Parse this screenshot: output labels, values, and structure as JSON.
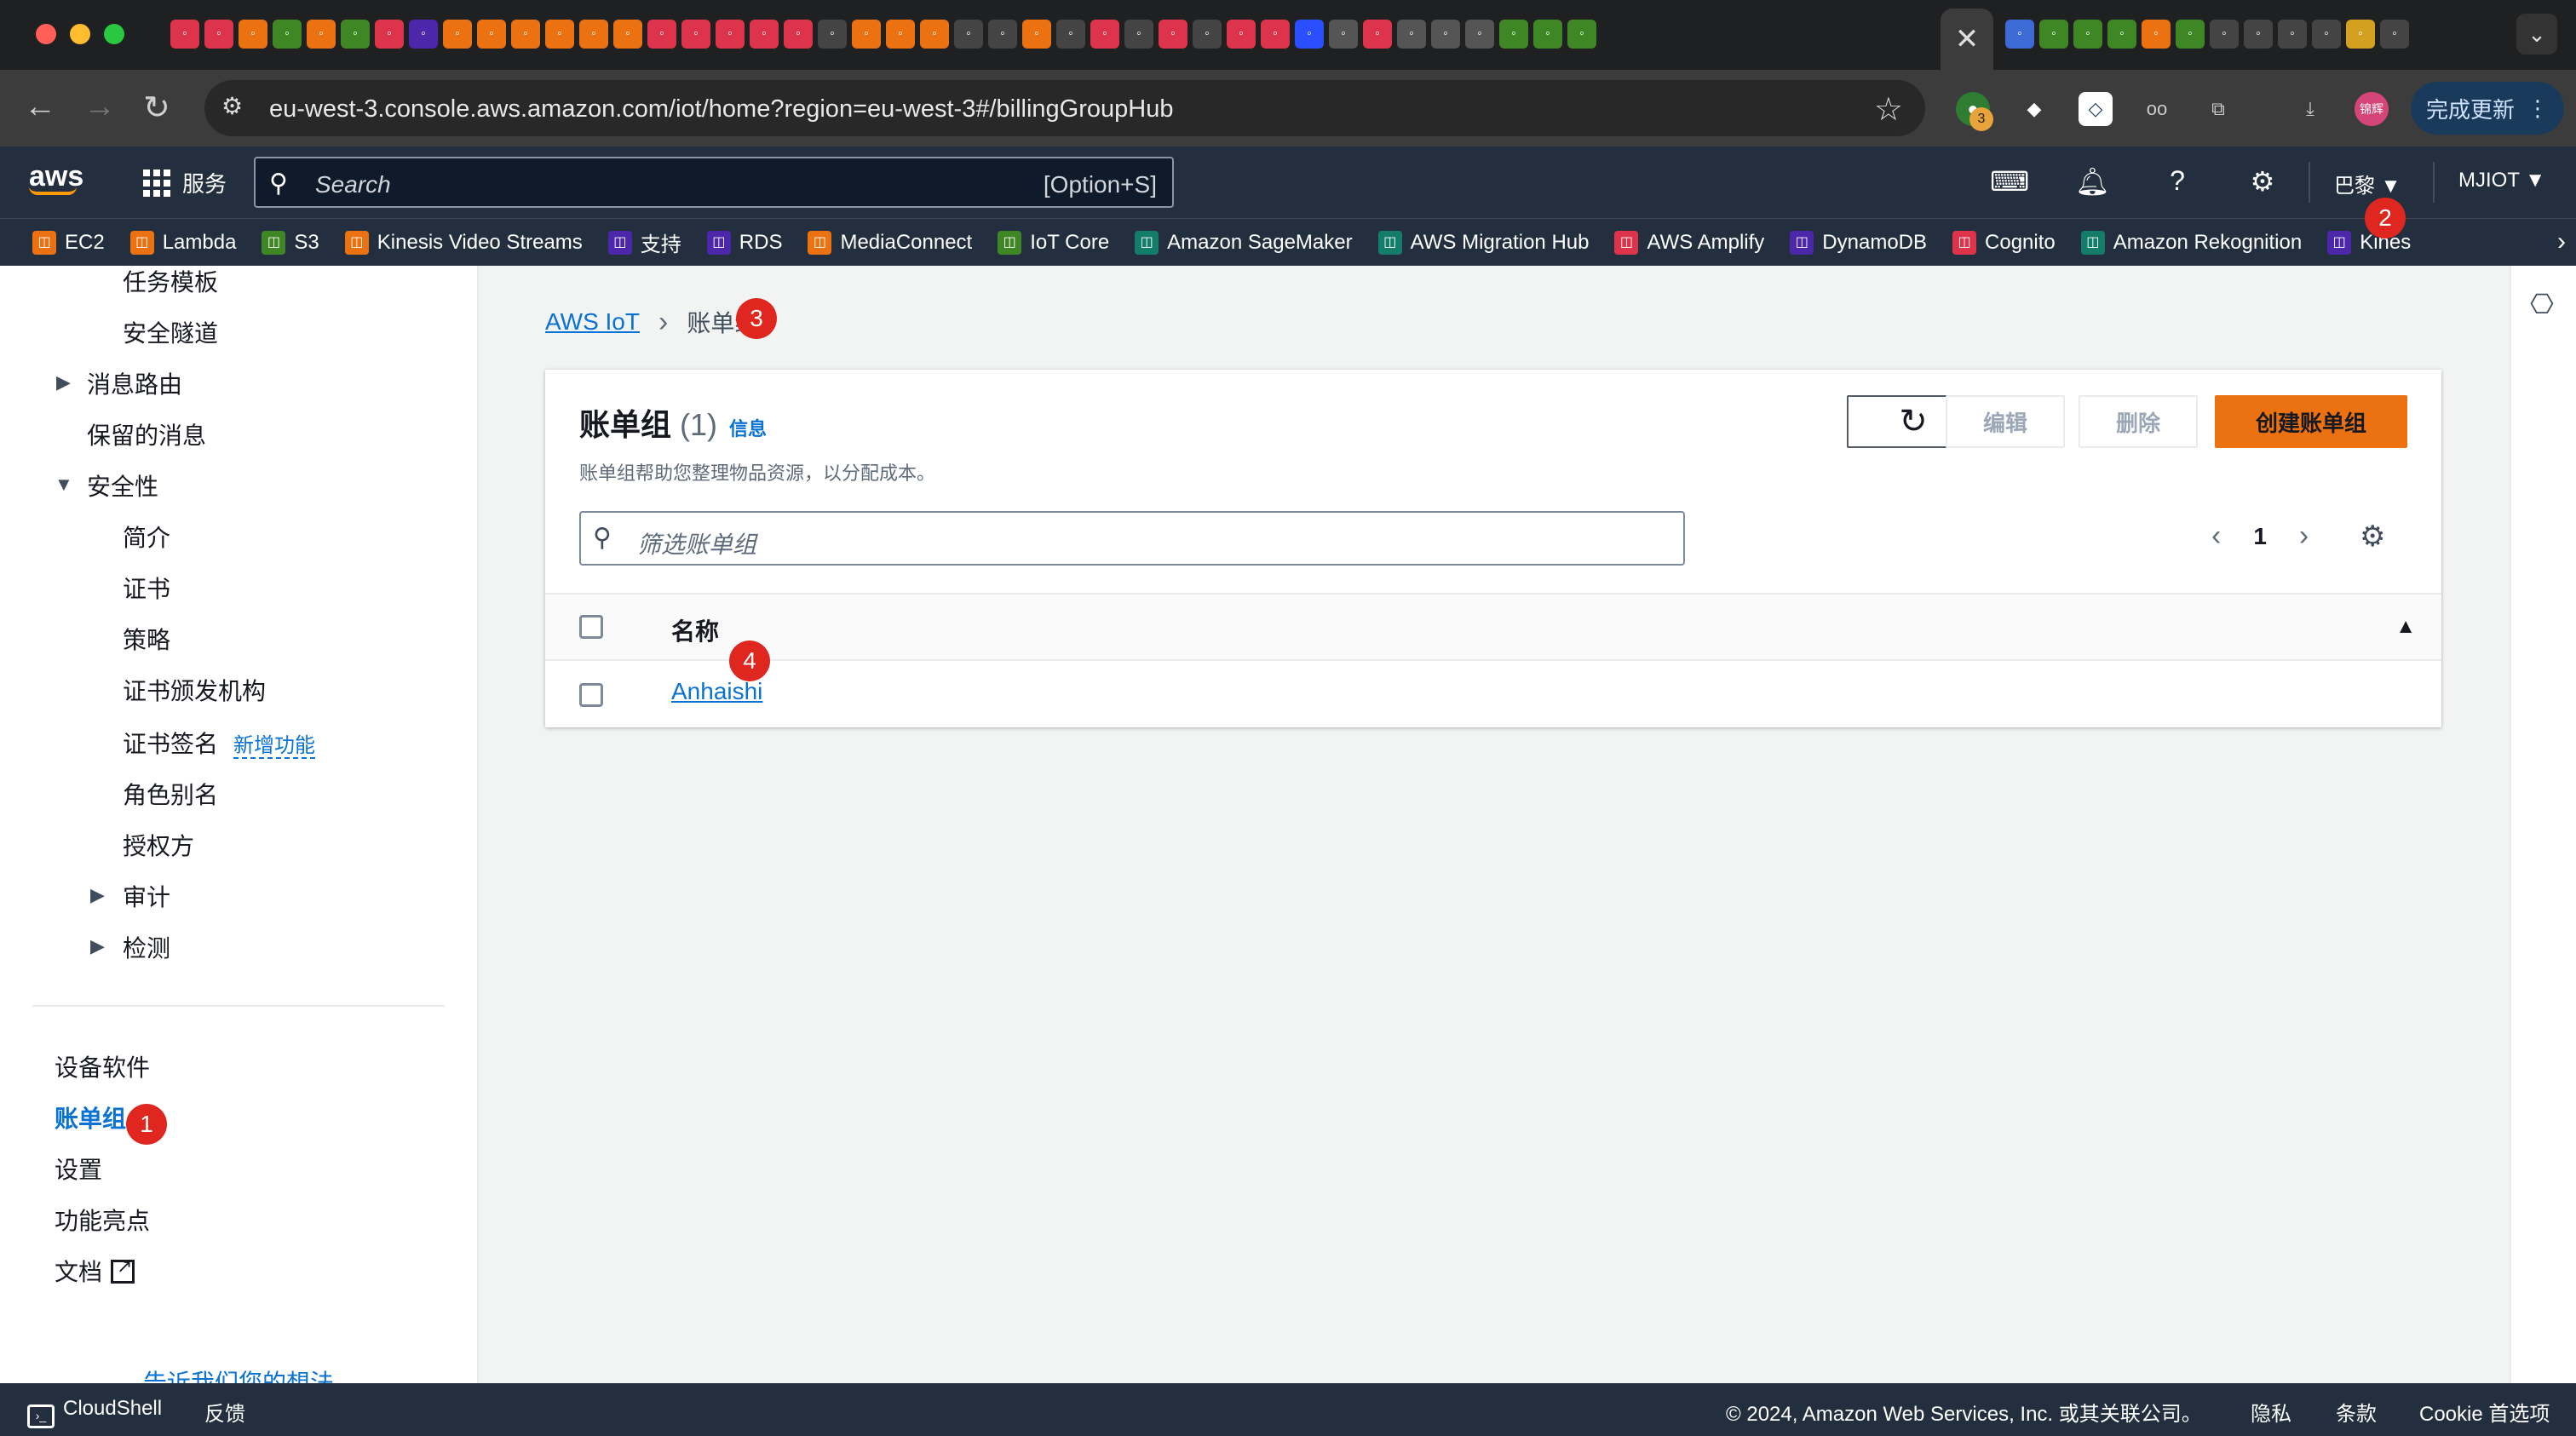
{
  "browser": {
    "url": "eu-west-3.console.aws.amazon.com/iot/home?region=eu-west-3#/billingGroupHub",
    "update_label": "完成更新",
    "ext_badge_count": "3",
    "profile_label": "锦辉"
  },
  "aws_header": {
    "logo": "aws",
    "services_label": "服务",
    "search_placeholder": "Search",
    "search_shortcut": "[Option+S]",
    "region": "巴黎",
    "account": "MJIOT"
  },
  "favorites": [
    {
      "label": "EC2",
      "color": "#ec7211"
    },
    {
      "label": "Lambda",
      "color": "#ec7211"
    },
    {
      "label": "S3",
      "color": "#3f8624"
    },
    {
      "label": "Kinesis Video Streams",
      "color": "#ec7211"
    },
    {
      "label": "支持",
      "color": "#4d27aa"
    },
    {
      "label": "RDS",
      "color": "#4d27aa"
    },
    {
      "label": "MediaConnect",
      "color": "#ec7211"
    },
    {
      "label": "IoT Core",
      "color": "#3f8624"
    },
    {
      "label": "Amazon SageMaker",
      "color": "#137d6a"
    },
    {
      "label": "AWS Migration Hub",
      "color": "#137d6a"
    },
    {
      "label": "AWS Amplify",
      "color": "#dd344c"
    },
    {
      "label": "DynamoDB",
      "color": "#4d27aa"
    },
    {
      "label": "Cognito",
      "color": "#dd344c"
    },
    {
      "label": "Amazon Rekognition",
      "color": "#137d6a"
    },
    {
      "label": "Kines",
      "color": "#4d27aa"
    }
  ],
  "sidebar": {
    "items": [
      "任务模板",
      "安全隧道",
      "消息路由",
      "保留的消息",
      "安全性",
      "简介",
      "证书",
      "策略",
      "证书颁发机构",
      "证书签名",
      "角色别名",
      "授权方",
      "审计",
      "检测",
      "设备软件",
      "账单组",
      "设置",
      "功能亮点",
      "文档",
      "告诉我们您的想法"
    ],
    "new_tag": "新增功能"
  },
  "breadcrumb": {
    "root": "AWS IoT",
    "current": "账单组"
  },
  "panel": {
    "title": "账单组",
    "count": "(1)",
    "info": "信息",
    "description": "账单组帮助您整理物品资源，以分配成本。",
    "buttons": {
      "edit": "编辑",
      "delete": "删除",
      "create": "创建账单组"
    },
    "filter_placeholder": "筛选账单组",
    "page": "1",
    "column_name": "名称",
    "rows": [
      "Anhaishi"
    ]
  },
  "badges": [
    "1",
    "2",
    "3",
    "4"
  ],
  "footer": {
    "cloudshell": "CloudShell",
    "feedback": "反馈",
    "copyright": "© 2024, Amazon Web Services, Inc. 或其关联公司。",
    "privacy": "隐私",
    "terms": "条款",
    "cookie": "Cookie 首选项"
  }
}
